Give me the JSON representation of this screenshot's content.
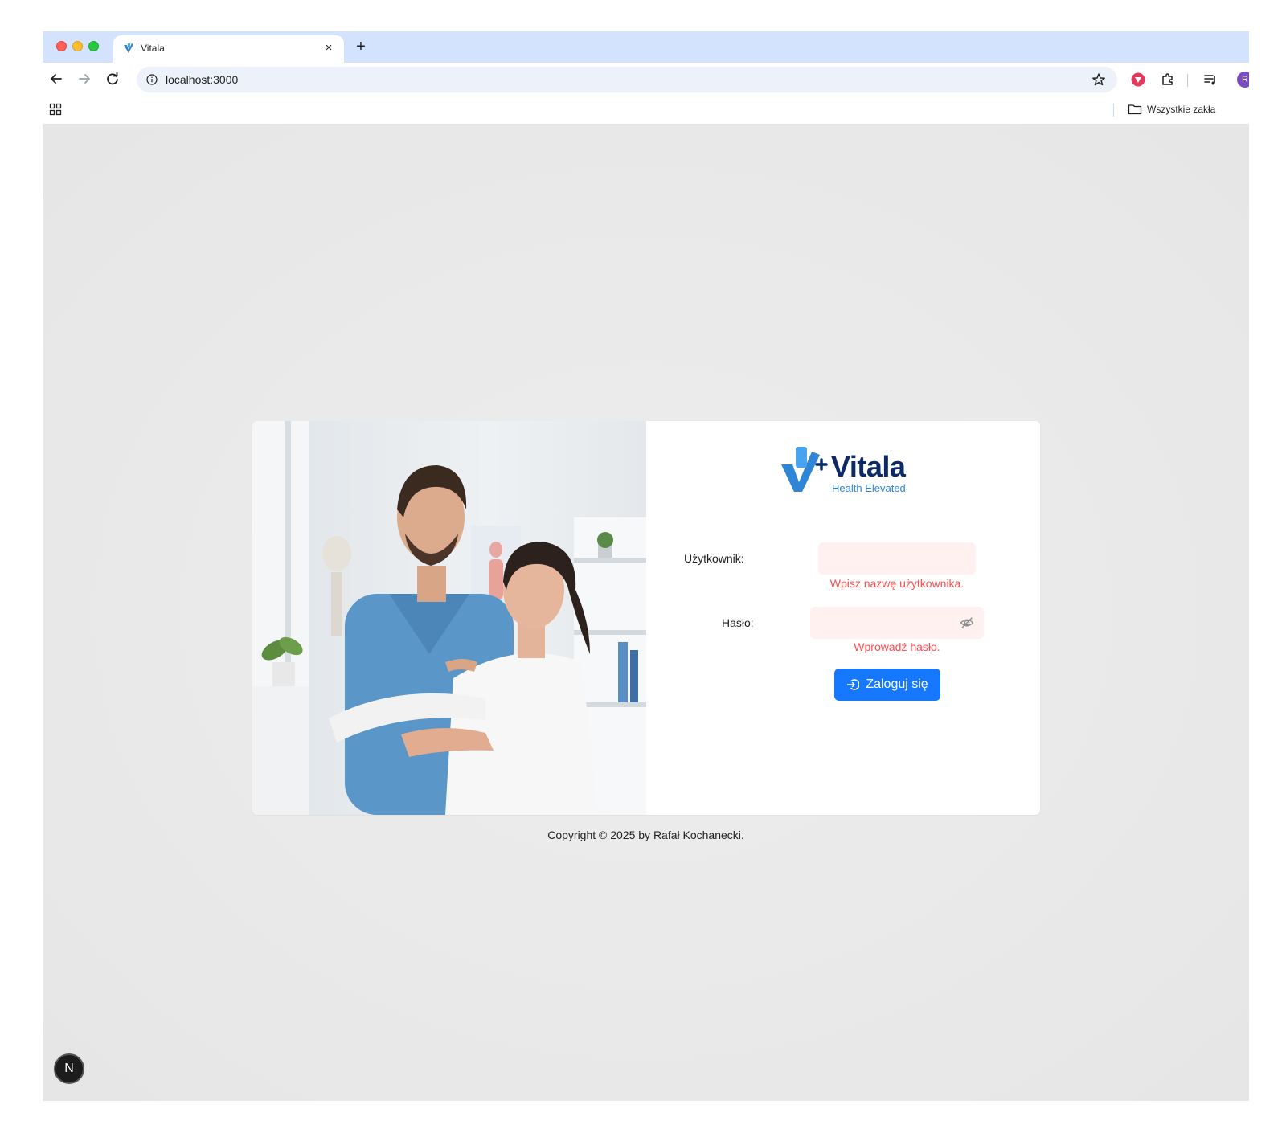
{
  "browser": {
    "tab_title": "Vitala",
    "tab_close": "×",
    "new_tab": "+",
    "url": "localhost:3000",
    "bookmarks_folder": "Wszystkie zakła",
    "avatar_initial": "R"
  },
  "login": {
    "brand_name": "Vitala",
    "brand_tagline": "Health Elevated",
    "username_label": "Użytkownik:",
    "username_value": "",
    "username_error": "Wpisz nazwę użytkownika.",
    "password_label": "Hasło:",
    "password_value": "",
    "password_error": "Wprowadź hasło.",
    "submit_label": "Zaloguj się",
    "photo_alt": "Physiotherapist assisting a patient with an arm exercise"
  },
  "footer": {
    "copyright": "Copyright © 2025 by Rafał Kochanecki."
  },
  "dev_badge": "N",
  "colors": {
    "primary": "#1677ff",
    "error": "#ff4d4f",
    "input_error_bg": "#fff1f0",
    "brand_navy": "#0b2a66",
    "brand_blue": "#2f86d6"
  },
  "icons": {
    "back": "arrow-left-icon",
    "forward": "arrow-right-icon",
    "reload": "reload-icon",
    "site_info": "info-icon",
    "bookmark": "star-icon",
    "password_visibility": "eye-off-icon",
    "login": "login-icon"
  }
}
